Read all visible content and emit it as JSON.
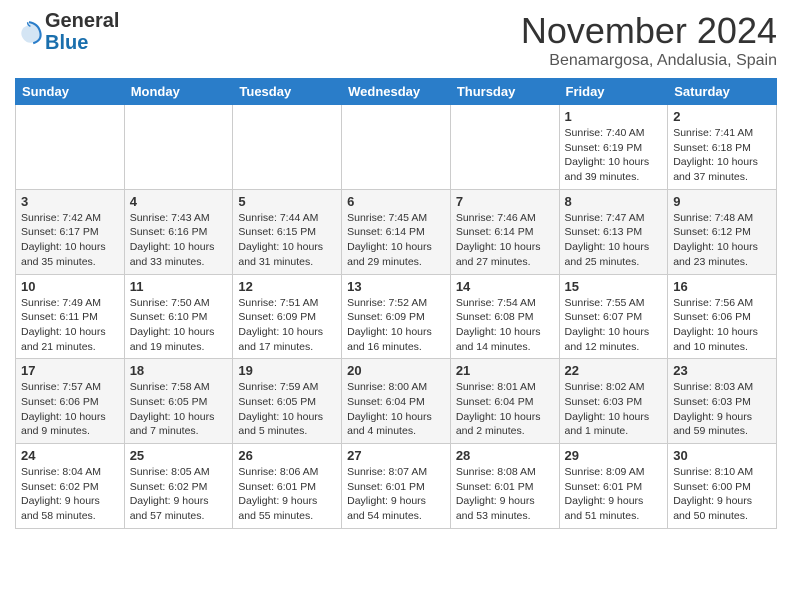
{
  "header": {
    "logo_line1": "General",
    "logo_line2": "Blue",
    "month": "November 2024",
    "location": "Benamargosa, Andalusia, Spain"
  },
  "weekdays": [
    "Sunday",
    "Monday",
    "Tuesday",
    "Wednesday",
    "Thursday",
    "Friday",
    "Saturday"
  ],
  "weeks": [
    [
      {
        "day": "",
        "info": ""
      },
      {
        "day": "",
        "info": ""
      },
      {
        "day": "",
        "info": ""
      },
      {
        "day": "",
        "info": ""
      },
      {
        "day": "",
        "info": ""
      },
      {
        "day": "1",
        "info": "Sunrise: 7:40 AM\nSunset: 6:19 PM\nDaylight: 10 hours and 39 minutes."
      },
      {
        "day": "2",
        "info": "Sunrise: 7:41 AM\nSunset: 6:18 PM\nDaylight: 10 hours and 37 minutes."
      }
    ],
    [
      {
        "day": "3",
        "info": "Sunrise: 7:42 AM\nSunset: 6:17 PM\nDaylight: 10 hours and 35 minutes."
      },
      {
        "day": "4",
        "info": "Sunrise: 7:43 AM\nSunset: 6:16 PM\nDaylight: 10 hours and 33 minutes."
      },
      {
        "day": "5",
        "info": "Sunrise: 7:44 AM\nSunset: 6:15 PM\nDaylight: 10 hours and 31 minutes."
      },
      {
        "day": "6",
        "info": "Sunrise: 7:45 AM\nSunset: 6:14 PM\nDaylight: 10 hours and 29 minutes."
      },
      {
        "day": "7",
        "info": "Sunrise: 7:46 AM\nSunset: 6:14 PM\nDaylight: 10 hours and 27 minutes."
      },
      {
        "day": "8",
        "info": "Sunrise: 7:47 AM\nSunset: 6:13 PM\nDaylight: 10 hours and 25 minutes."
      },
      {
        "day": "9",
        "info": "Sunrise: 7:48 AM\nSunset: 6:12 PM\nDaylight: 10 hours and 23 minutes."
      }
    ],
    [
      {
        "day": "10",
        "info": "Sunrise: 7:49 AM\nSunset: 6:11 PM\nDaylight: 10 hours and 21 minutes."
      },
      {
        "day": "11",
        "info": "Sunrise: 7:50 AM\nSunset: 6:10 PM\nDaylight: 10 hours and 19 minutes."
      },
      {
        "day": "12",
        "info": "Sunrise: 7:51 AM\nSunset: 6:09 PM\nDaylight: 10 hours and 17 minutes."
      },
      {
        "day": "13",
        "info": "Sunrise: 7:52 AM\nSunset: 6:09 PM\nDaylight: 10 hours and 16 minutes."
      },
      {
        "day": "14",
        "info": "Sunrise: 7:54 AM\nSunset: 6:08 PM\nDaylight: 10 hours and 14 minutes."
      },
      {
        "day": "15",
        "info": "Sunrise: 7:55 AM\nSunset: 6:07 PM\nDaylight: 10 hours and 12 minutes."
      },
      {
        "day": "16",
        "info": "Sunrise: 7:56 AM\nSunset: 6:06 PM\nDaylight: 10 hours and 10 minutes."
      }
    ],
    [
      {
        "day": "17",
        "info": "Sunrise: 7:57 AM\nSunset: 6:06 PM\nDaylight: 10 hours and 9 minutes."
      },
      {
        "day": "18",
        "info": "Sunrise: 7:58 AM\nSunset: 6:05 PM\nDaylight: 10 hours and 7 minutes."
      },
      {
        "day": "19",
        "info": "Sunrise: 7:59 AM\nSunset: 6:05 PM\nDaylight: 10 hours and 5 minutes."
      },
      {
        "day": "20",
        "info": "Sunrise: 8:00 AM\nSunset: 6:04 PM\nDaylight: 10 hours and 4 minutes."
      },
      {
        "day": "21",
        "info": "Sunrise: 8:01 AM\nSunset: 6:04 PM\nDaylight: 10 hours and 2 minutes."
      },
      {
        "day": "22",
        "info": "Sunrise: 8:02 AM\nSunset: 6:03 PM\nDaylight: 10 hours and 1 minute."
      },
      {
        "day": "23",
        "info": "Sunrise: 8:03 AM\nSunset: 6:03 PM\nDaylight: 9 hours and 59 minutes."
      }
    ],
    [
      {
        "day": "24",
        "info": "Sunrise: 8:04 AM\nSunset: 6:02 PM\nDaylight: 9 hours and 58 minutes."
      },
      {
        "day": "25",
        "info": "Sunrise: 8:05 AM\nSunset: 6:02 PM\nDaylight: 9 hours and 57 minutes."
      },
      {
        "day": "26",
        "info": "Sunrise: 8:06 AM\nSunset: 6:01 PM\nDaylight: 9 hours and 55 minutes."
      },
      {
        "day": "27",
        "info": "Sunrise: 8:07 AM\nSunset: 6:01 PM\nDaylight: 9 hours and 54 minutes."
      },
      {
        "day": "28",
        "info": "Sunrise: 8:08 AM\nSunset: 6:01 PM\nDaylight: 9 hours and 53 minutes."
      },
      {
        "day": "29",
        "info": "Sunrise: 8:09 AM\nSunset: 6:01 PM\nDaylight: 9 hours and 51 minutes."
      },
      {
        "day": "30",
        "info": "Sunrise: 8:10 AM\nSunset: 6:00 PM\nDaylight: 9 hours and 50 minutes."
      }
    ]
  ]
}
